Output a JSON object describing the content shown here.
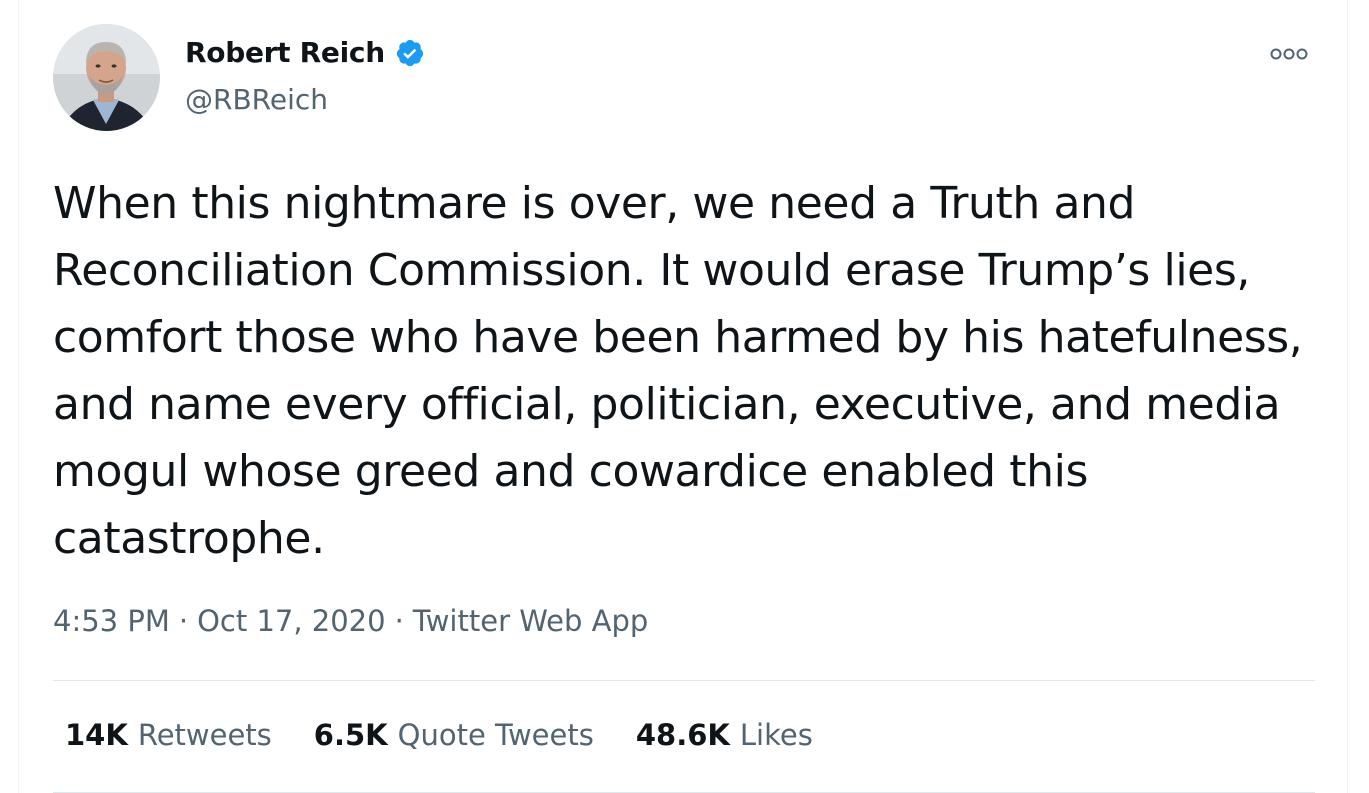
{
  "author": {
    "display_name": "Robert Reich",
    "handle": "@RBReich",
    "verified": true,
    "verified_icon": "verified-badge-icon",
    "verified_color": "#1d9bf0"
  },
  "tweet": {
    "text": "When this nightmare is over, we need a Truth and Reconciliation Commission. It would erase Trump’s lies, comfort those who have been harmed by his hatefulness, and name every official, politician, executive, and media mogul whose greed and cowardice enabled this catastrophe.",
    "time": "4:53 PM",
    "date": "Oct 17, 2020",
    "source": "Twitter Web App",
    "separator": "·"
  },
  "stats": {
    "retweets": {
      "count": "14K",
      "label": "Retweets"
    },
    "quote_tweets": {
      "count": "6.5K",
      "label": "Quote Tweets"
    },
    "likes": {
      "count": "48.6K",
      "label": "Likes"
    }
  },
  "menu": {
    "icon": "more-options-icon"
  },
  "colors": {
    "text_primary": "#0f1419",
    "text_secondary": "#536471",
    "divider": "#e1e8ed"
  }
}
